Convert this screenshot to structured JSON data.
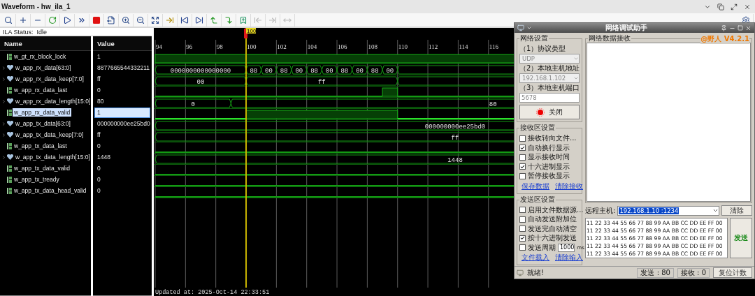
{
  "window": {
    "title": "Waveform - hw_ila_1"
  },
  "toolbar": [
    {
      "kind": "search",
      "disabled": false
    },
    {
      "kind": "add",
      "disabled": false
    },
    {
      "kind": "remove",
      "disabled": false
    },
    {
      "kind": "refresh",
      "disabled": false
    },
    {
      "kind": "run",
      "disabled": false
    },
    {
      "kind": "run-now",
      "disabled": false
    },
    {
      "kind": "stop",
      "disabled": false
    },
    {
      "kind": "export",
      "disabled": false
    },
    {
      "kind": "zoom-in",
      "disabled": false
    },
    {
      "kind": "zoom-out",
      "disabled": false
    },
    {
      "kind": "zoom-fit",
      "disabled": false
    },
    {
      "kind": "to-cursor",
      "disabled": false
    },
    {
      "kind": "first",
      "disabled": false
    },
    {
      "kind": "last",
      "disabled": false
    },
    {
      "kind": "prev-edge",
      "disabled": false
    },
    {
      "kind": "next-edge",
      "disabled": false
    },
    {
      "kind": "add-marker",
      "disabled": false
    },
    {
      "kind": "prev-marker",
      "disabled": true
    },
    {
      "kind": "next-marker",
      "disabled": true
    },
    {
      "kind": "swap",
      "disabled": true
    }
  ],
  "ila_status": {
    "label": "ILA Status:",
    "value": "Idle"
  },
  "columns": [
    "Name",
    "Value"
  ],
  "cursor": {
    "label": "100"
  },
  "time_axis": [
    "94",
    "96",
    "98",
    "100",
    "102",
    "104",
    "106",
    "108",
    "110",
    "112",
    "114",
    "116"
  ],
  "signals": [
    {
      "name": "w_gt_rx_block_lock",
      "kind": "bit",
      "value": "1",
      "selected": false,
      "segments": [
        {
          "high": true
        }
      ]
    },
    {
      "name": "w_app_rx_data[63:0]",
      "kind": "bus",
      "value": "8877665544332211",
      "selected": false,
      "segments": [
        {
          "label": "0000000000000000"
        },
        {
          "label": "88"
        },
        {
          "label": "00"
        },
        {
          "label": "88"
        },
        {
          "label": "00"
        },
        {
          "label": "88"
        },
        {
          "label": "00"
        },
        {
          "label": "88"
        },
        {
          "label": "00"
        },
        {
          "label": "88"
        },
        {
          "label": "00"
        }
      ]
    },
    {
      "name": "w_app_rx_data_keep[7:0]",
      "kind": "bus",
      "value": "ff",
      "selected": false,
      "segments": [
        {
          "label": "00"
        },
        {
          "label": "ff"
        }
      ]
    },
    {
      "name": "w_app_rx_data_last",
      "kind": "bit",
      "value": "0",
      "selected": false,
      "segments": [
        {
          "high": false
        },
        {
          "high": true
        },
        {
          "high": false
        }
      ]
    },
    {
      "name": "w_app_rx_data_length[15:0]",
      "kind": "bus",
      "value": "80",
      "selected": false,
      "segments": [
        {
          "label": "0"
        },
        {
          "label": "80"
        }
      ]
    },
    {
      "name": "w_app_rx_data_valid",
      "kind": "bit",
      "value": "1",
      "selected": true,
      "segments": [
        {
          "high": false
        },
        {
          "high": true
        },
        {
          "high": false
        }
      ]
    },
    {
      "name": "w_app_tx_data[63:0]",
      "kind": "bus",
      "value": "000000000ee25bd0",
      "selected": false,
      "segments": [
        {
          "label": "000000000ee25bd0"
        }
      ]
    },
    {
      "name": "w_app_tx_data_keep[7:0]",
      "kind": "bus",
      "value": "ff",
      "selected": false,
      "segments": [
        {
          "label": "ff"
        }
      ]
    },
    {
      "name": "w_app_tx_data_last",
      "kind": "bit",
      "value": "0",
      "selected": false,
      "segments": [
        {
          "high": false
        }
      ]
    },
    {
      "name": "w_app_tx_data_length[15:0]",
      "kind": "bus",
      "value": "1448",
      "selected": false,
      "segments": [
        {
          "label": "1448"
        }
      ]
    },
    {
      "name": "w_app_tx_data_valid",
      "kind": "bit",
      "value": "0",
      "selected": false,
      "segments": [
        {
          "high": false
        }
      ]
    },
    {
      "name": "w_app_tx_tready",
      "kind": "bit",
      "value": "0",
      "selected": false,
      "segments": [
        {
          "high": false
        }
      ]
    },
    {
      "name": "w_app_tx_data_head_valid",
      "kind": "bit",
      "value": "0",
      "selected": false,
      "segments": [
        {
          "high": false
        }
      ]
    }
  ],
  "updated": "Updated at: 2025-Oct-14 22:33:51",
  "net_assistant": {
    "title": "网络调试助手",
    "settings_group": {
      "title": "网络设置",
      "protocol_label": "（1）协议类型",
      "protocol": "UDP",
      "host_label": "（2）本地主机地址",
      "host": "192.168.1.102",
      "port_label": "（3）本地主机端口",
      "port": "5678",
      "connect_button": "关闭"
    },
    "receive_group": {
      "title": "接收区设置",
      "options": [
        {
          "kind": "plain",
          "label": "接收转向文件...",
          "checked": false
        },
        {
          "kind": "plain",
          "label": "自动换行显示",
          "checked": true
        },
        {
          "kind": "plain",
          "label": "显示接收时间",
          "checked": false
        },
        {
          "kind": "plain",
          "label": "十六进制显示",
          "checked": true
        },
        {
          "kind": "plain",
          "label": "暂停接收显示",
          "checked": false
        }
      ],
      "links": [
        "保存数据",
        "清除接收"
      ]
    },
    "send_group": {
      "title": "发送区设置",
      "options": [
        {
          "kind": "plain",
          "label": "启用文件数据源...",
          "checked": false
        },
        {
          "kind": "plain",
          "label": "自动发送附加位",
          "checked": false
        },
        {
          "kind": "plain",
          "label": "发送完自动清空",
          "checked": false
        },
        {
          "kind": "plain",
          "label": "按十六进制发送",
          "checked": true
        },
        {
          "kind": "period",
          "label": "发送周期",
          "checked": false,
          "value": "1000",
          "unit": "ms"
        }
      ],
      "links": [
        "文件载入",
        "清除输入"
      ]
    },
    "receive_panel": {
      "title": "网络数据接收",
      "version": "@野人 V4.2.1"
    },
    "remote_label": "远程主机:",
    "remote_host": "192.168.1.10 :1234",
    "clear_button": "清除",
    "send_lines": [
      "11 22 33 44 55 66 77 88 99 AA BB CC DD EE FF 00",
      "11 22 33 44 55 66 77 88 99 AA BB CC DD EE FF 00",
      "11 22 33 44 55 66 77 88 99 AA BB CC DD EE FF 00",
      "11 22 33 44 55 66 77 88 99 AA BB CC DD EE FF 00",
      "11 22 33 44 55 66 77 88 99 AA BB CC DD EE FF 00"
    ],
    "send_button": "发送",
    "status": {
      "text": "就绪!",
      "sent": "发送 : 80",
      "received": "接收 : 0",
      "reset_button": "复位计数"
    }
  }
}
